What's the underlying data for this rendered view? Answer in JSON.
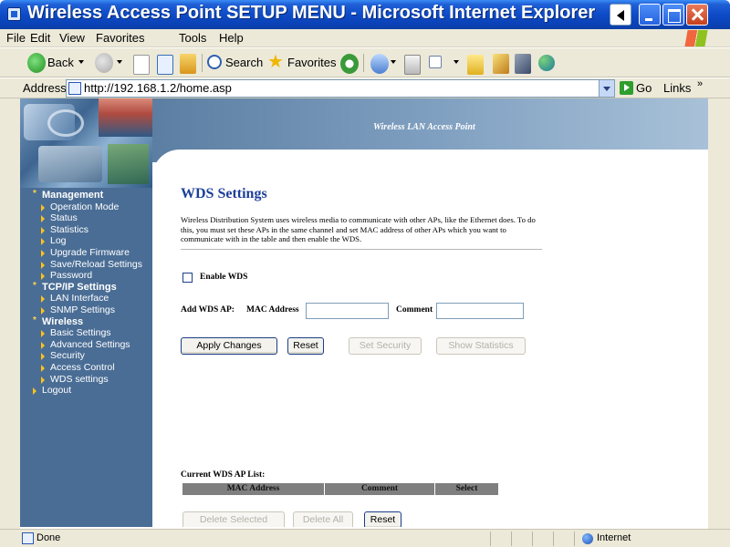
{
  "window": {
    "title": "Wireless Access Point SETUP MENU - Microsoft Internet Explorer"
  },
  "menubar": {
    "items": [
      "File",
      "Edit",
      "View",
      "Favorites",
      "Tools",
      "Help"
    ]
  },
  "toolbar": {
    "back_label": "Back",
    "search_label": "Search",
    "favorites_label": "Favorites"
  },
  "addressbar": {
    "label": "Address",
    "url": "http://192.168.1.2/home.asp",
    "go_label": "Go",
    "links_label": "Links",
    "chevron": "»"
  },
  "banner": {
    "brand": "Wireless LAN Access Point"
  },
  "sidebar": {
    "management": {
      "label": "Management",
      "items": [
        "Operation Mode",
        "Status",
        "Statistics",
        "Log",
        "Upgrade Firmware",
        "Save/Reload Settings",
        "Password"
      ]
    },
    "tcpip": {
      "label": "TCP/IP Settings",
      "items": [
        "LAN Interface",
        "SNMP Settings"
      ]
    },
    "wireless": {
      "label": "Wireless",
      "items": [
        "Basic Settings",
        "Advanced Settings",
        "Security",
        "Access Control",
        "WDS settings"
      ]
    },
    "logout": "Logout"
  },
  "page": {
    "title": "WDS Settings",
    "description": "Wireless Distribution System uses wireless media to communicate with other APs, like the Ethernet does. To do this, you must set these APs in the same channel and set MAC address of other APs which you want to communicate with in the table and then enable the WDS.",
    "enable_label": "Enable WDS",
    "enable_checked": false,
    "add_label": "Add WDS AP:",
    "mac_label": "MAC Address",
    "mac_value": "",
    "comment_label": "Comment",
    "comment_value": "",
    "buttons": {
      "apply": "Apply Changes",
      "reset": "Reset",
      "set_security": "Set Security",
      "show_statistics": "Show Statistics"
    },
    "list": {
      "title": "Current WDS AP List:",
      "columns": [
        "MAC Address",
        "Comment",
        "Select"
      ],
      "rows": []
    },
    "list_buttons": {
      "delete_selected": "Delete Selected",
      "delete_all": "Delete All",
      "reset": "Reset"
    }
  },
  "statusbar": {
    "status": "Done",
    "zone": "Internet"
  }
}
